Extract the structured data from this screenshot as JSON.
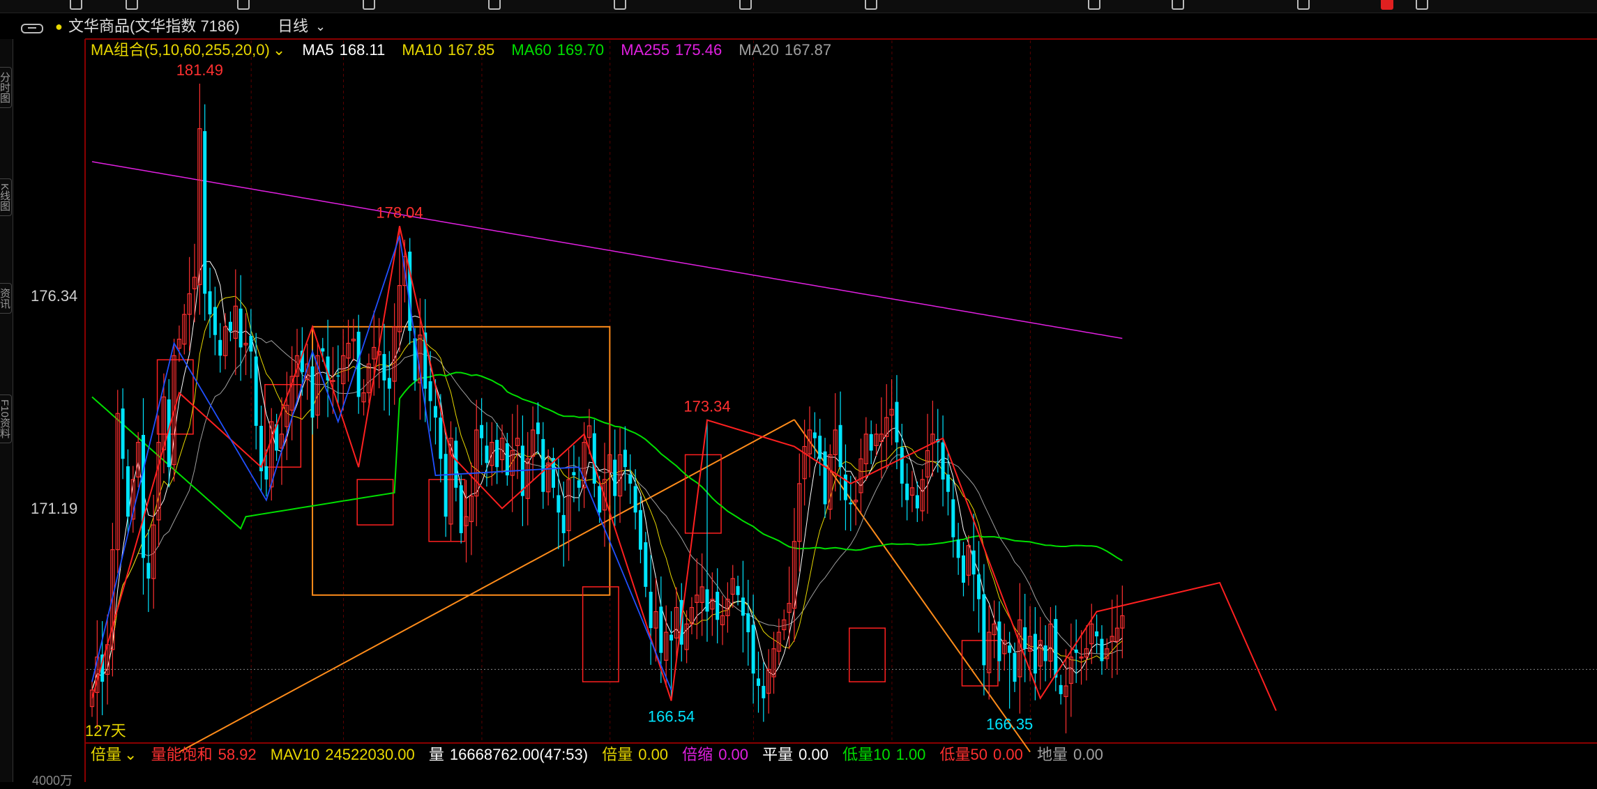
{
  "titlebar": {
    "name": "文华商品(文华指数 7186)",
    "period": "日线",
    "period_caret": "⌄"
  },
  "colors": {
    "up": "#ff3030",
    "down": "#00e5ff",
    "ma5": "#ffffff",
    "ma10": "#e8d800",
    "ma60": "#00e000",
    "ma255": "#e020e0",
    "ma20": "#a0a0a0",
    "zigzag": "#ff2020",
    "zigzag2": "#2050ff",
    "orange": "#ff8c1a"
  },
  "ma_legend": {
    "combo_label": "MA组合(5,10,60,255,20,0)",
    "combo_caret": "⌄",
    "ma5_label": "MA5",
    "ma5_value": "168.11",
    "ma10_label": "MA10",
    "ma10_value": "167.85",
    "ma60_label": "MA60",
    "ma60_value": "169.70",
    "ma255_label": "MA255",
    "ma255_value": "175.46",
    "ma20_label": "MA20",
    "ma20_value": "167.87"
  },
  "vol_legend": {
    "beiliang_label": "倍量",
    "beiliang_caret": "⌄",
    "lnbh_label": "量能饱和",
    "lnbh_value": "58.92",
    "mav10_label": "MAV10",
    "mav10_value": "24522030.00",
    "liang_label": "量",
    "liang_value": "16668762.00(47:53)",
    "beiliang2_label": "倍量",
    "beiliang2_value": "0.00",
    "beisuo_label": "倍缩",
    "beisuo_value": "0.00",
    "pingliang_label": "平量",
    "pingliang_value": "0.00",
    "diliang10_label": "低量10",
    "diliang10_value": "1.00",
    "diliang50_label": "低量50",
    "diliang50_value": "0.00",
    "diliang_label": "地量",
    "diliang_value": "0.00"
  },
  "bottom_axis_label": "4000万",
  "left_tabs": [
    "分时图",
    "K线图",
    "资讯",
    "F10资料"
  ],
  "chart_data": {
    "type": "candlestick",
    "title": "",
    "ylim": [
      165.3,
      182.3
    ],
    "yticks": [
      176.34,
      171.19
    ],
    "day_count_label": "127天",
    "peak_labels": [
      {
        "text": "181.49",
        "kind": "high",
        "bar": 21
      },
      {
        "text": "178.04",
        "kind": "high",
        "bar": 60
      },
      {
        "text": "173.34",
        "kind": "high",
        "bar": 120
      },
      {
        "text": "166.54",
        "kind": "low",
        "bar": 113
      },
      {
        "text": "166.35",
        "kind": "low",
        "bar": 179
      }
    ],
    "close_guide": 167.3,
    "closes": [
      166.8,
      167.6,
      167.0,
      167.9,
      170.2,
      173.5,
      172.4,
      171.0,
      171.9,
      172.8,
      170.0,
      169.5,
      170.8,
      172.8,
      173.9,
      172.2,
      174.9,
      175.3,
      175.9,
      176.4,
      176.8,
      180.4,
      176.4,
      175.9,
      175.4,
      174.9,
      175.6,
      175.5,
      176.1,
      175.1,
      175.2,
      175.0,
      173.2,
      172.1,
      171.9,
      173.3,
      172.6,
      173.0,
      173.7,
      174.4,
      174.9,
      174.5,
      174.7,
      173.4,
      174.9,
      175.0,
      174.3,
      174.3,
      174.4,
      174.9,
      175.2,
      175.3,
      173.9,
      174.0,
      174.7,
      175.1,
      175.0,
      174.3,
      174.1,
      175.6,
      176.6,
      177.3,
      175.5,
      174.3,
      175.4,
      174.1,
      173.8,
      173.4,
      172.4,
      171.0,
      172.9,
      171.7,
      170.6,
      171.0,
      171.5,
      173.1,
      172.9,
      172.3,
      172.8,
      172.2,
      172.9,
      172.0,
      172.6,
      172.9,
      171.5,
      172.4,
      173.1,
      173.0,
      171.6,
      172.3,
      171.7,
      171.1,
      170.6,
      171.9,
      172.0,
      171.7,
      172.8,
      173.2,
      171.8,
      171.1,
      171.9,
      172.5,
      171.5,
      172.5,
      172.2,
      171.8,
      171.1,
      170.2,
      169.3,
      168.3,
      168.7,
      167.7,
      168.2,
      168.0,
      168.8,
      167.9,
      168.4,
      168.8,
      169.1,
      169.3,
      168.7,
      169.0,
      168.5,
      168.6,
      169.0,
      169.5,
      169.1,
      168.6,
      168.2,
      167.2,
      166.9,
      166.6,
      167.3,
      167.8,
      168.2,
      168.5,
      168.9,
      170.4,
      171.8,
      172.7,
      173.1,
      172.9,
      172.4,
      171.3,
      172.5,
      173.1,
      172.2,
      171.4,
      171.3,
      171.4,
      172.4,
      173.0,
      172.6,
      173.0,
      173.0,
      173.4,
      173.6,
      172.8,
      171.8,
      171.4,
      171.7,
      171.2,
      171.9,
      172.6,
      173.0,
      172.8,
      171.9,
      171.6,
      170.5,
      170.0,
      169.4,
      170.3,
      169.6,
      169.0,
      167.4,
      168.2,
      168.4,
      167.5,
      168.0,
      167.7,
      167.0,
      168.5,
      167.8,
      168.1,
      167.2,
      168.0,
      167.5,
      168.4,
      167.1,
      166.7,
      166.9,
      167.6,
      167.7,
      167.6,
      167.8,
      168.4,
      168.1,
      167.5,
      167.8,
      168.1,
      168.3,
      168.6
    ],
    "series": [
      {
        "name": "MA5",
        "value": 168.11
      },
      {
        "name": "MA10",
        "value": 167.85
      },
      {
        "name": "MA60",
        "value": 169.7
      },
      {
        "name": "MA255",
        "value": 175.46
      },
      {
        "name": "MA20",
        "value": 167.87
      }
    ]
  }
}
